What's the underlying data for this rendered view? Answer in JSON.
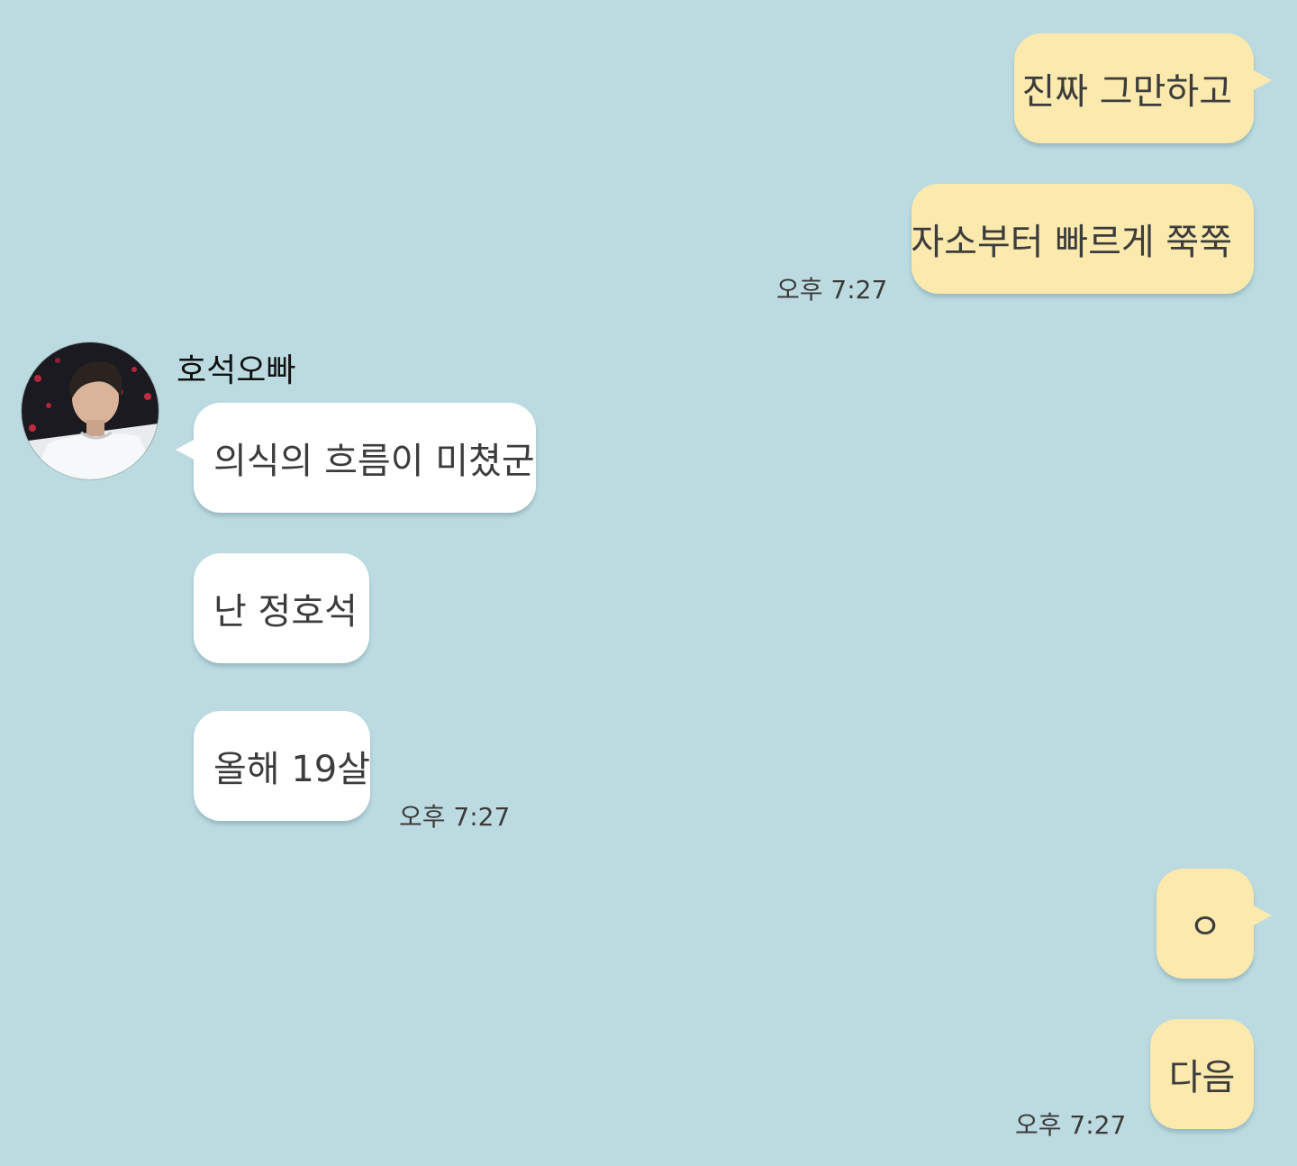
{
  "contact": {
    "name": "호석오빠"
  },
  "messages": [
    {
      "direction": "outgoing",
      "text": "진짜 그만하고"
    },
    {
      "direction": "outgoing",
      "text": "자소부터 빠르게 쭉쭉"
    },
    {
      "direction": "incoming",
      "text": "의식의 흐름이 미쳤군"
    },
    {
      "direction": "incoming",
      "text": "난 정호석"
    },
    {
      "direction": "incoming",
      "text": "올해 19살"
    },
    {
      "direction": "outgoing",
      "text": "ㅇ"
    },
    {
      "direction": "outgoing",
      "text": "다음"
    }
  ],
  "timestamps": {
    "group1": "오후 7:27",
    "group2": "오후 7:27",
    "group3": "오후 7:27"
  },
  "colors": {
    "background": "#bcdbe1",
    "outgoing_bubble": "#fbe9ad",
    "incoming_bubble": "#ffffff"
  }
}
